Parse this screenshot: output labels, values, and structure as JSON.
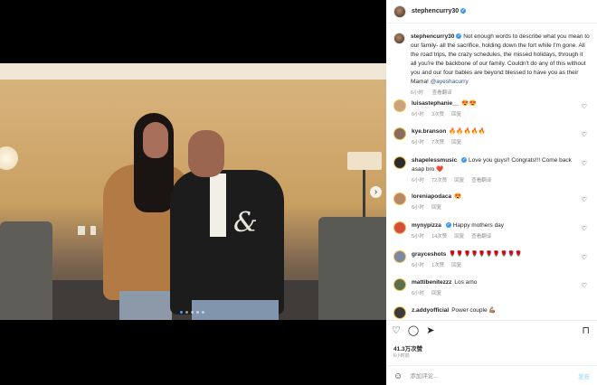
{
  "header": {
    "username": "stephencurry30"
  },
  "caption": {
    "username": "stephencurry30",
    "text": "Not enough words to describe what you mean to our family- all the sacrifice, holding down the fort while I'm gone. All the road trips, the crazy schedules, the missed holidays, through it all you're the backbone of our family. Couldn't do any of this without you and our four babies are beyond blessed to have you as their Mama!",
    "mention": "@ayeshacurry",
    "time": "6小时",
    "see_translation": "查看翻译"
  },
  "comments": [
    {
      "username": "luisastephanie__",
      "text": "😍😍",
      "time": "6小时",
      "likes": "3次赞",
      "reply": "回复",
      "avatar_color": "#c9a27e"
    },
    {
      "username": "kye.branson",
      "text": "🔥🔥🔥🔥🔥",
      "time": "6小时",
      "likes": "7次赞",
      "reply": "回复",
      "avatar_color": "#8a6b5c"
    },
    {
      "username": "shapelessmusic",
      "text": "Love you guys!! Congrats!!! Come back asap bro ❤️",
      "time": "6小时",
      "likes": "72次赞",
      "reply": "回复",
      "translate": "查看翻译",
      "avatar_color": "#2c2c2c"
    },
    {
      "username": "loreniapodaca",
      "text": "😍",
      "time": "6小时",
      "reply": "回复",
      "avatar_color": "#b8876a"
    },
    {
      "username": "mynypizza",
      "text": "Happy mothers day",
      "time": "5小时",
      "likes": "14次赞",
      "reply": "回复",
      "translate": "查看翻译",
      "avatar_color": "#d24f3c"
    },
    {
      "username": "grayceshots",
      "text": "🌹🌹🌹🌹🌹🌹🌹🌹🌹🌹",
      "time": "6小时",
      "likes": "1次赞",
      "reply": "回复",
      "avatar_color": "#7c8aa0"
    },
    {
      "username": "mattibenitezzz",
      "text": "Los amo",
      "time": "6小时",
      "reply": "回复",
      "avatar_color": "#5b6f4a"
    },
    {
      "username": "z.addyofficial",
      "text": "Power couple 💪🏽",
      "avatar_color": "#3b3b3b"
    }
  ],
  "stats": {
    "likes": "41.3万次赞",
    "time_ago": "6小时前"
  },
  "add_comment": {
    "placeholder": "添加评论...",
    "post": "发布"
  },
  "colors": {
    "verified": "#3897f0",
    "link": "#385185",
    "post_disabled": "#b2dffc",
    "active_dot": "#4aa1f5"
  },
  "icons": [
    "heart-icon",
    "comment-icon",
    "share-icon",
    "bookmark-icon",
    "emoji-icon",
    "next-arrow-icon"
  ]
}
